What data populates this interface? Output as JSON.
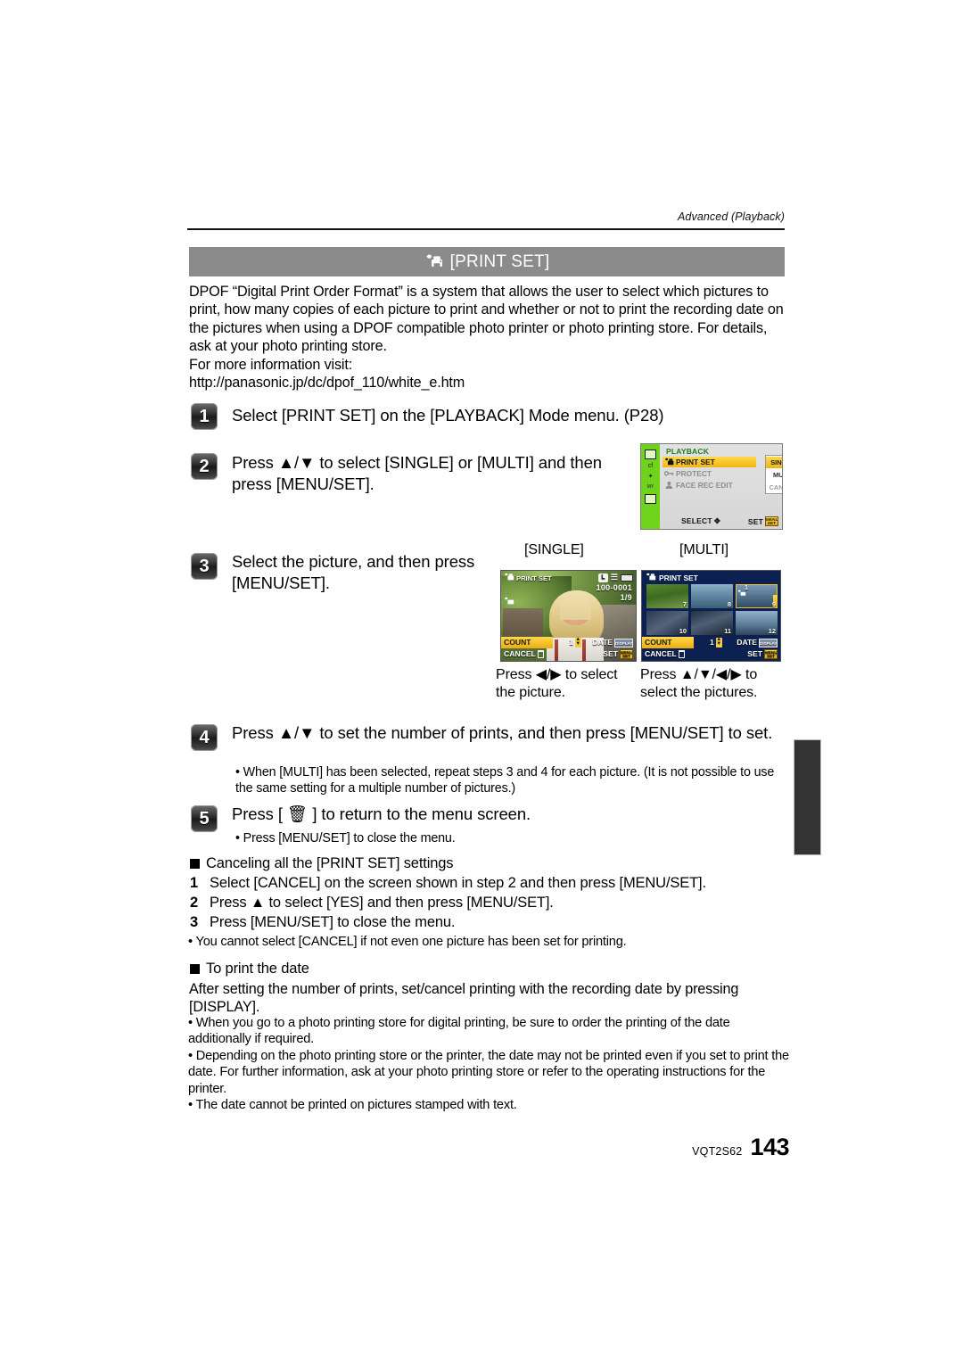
{
  "header": {
    "running_head": "Advanced (Playback)"
  },
  "banner": {
    "icon": "print-set-icon",
    "title": "[PRINT SET]"
  },
  "intro": {
    "paragraph": "DPOF “Digital Print Order Format” is a system that allows the user to select which pictures to print, how many copies of each picture to print and whether or not to print the recording date on the pictures when using a DPOF compatible photo printer or photo printing store. For details, ask at your photo printing store.",
    "more_info_label": "For more information visit:",
    "url": "http://panasonic.jp/dc/dpof_110/white_e.htm"
  },
  "steps": [
    {
      "num": "1",
      "text": "Select [PRINT SET] on the [PLAYBACK] Mode menu. (P28)"
    },
    {
      "num": "2",
      "text": "Press ▲/▼ to select [SINGLE] or [MULTI] and then press [MENU/SET]."
    },
    {
      "num": "3",
      "text": "Select the picture, and then press [MENU/SET]."
    },
    {
      "num": "4",
      "text": "Press ▲/▼ to set the number of prints, and then press [MENU/SET] to set."
    },
    {
      "num": "5",
      "text": "Press [ 🗑 ] to return to the menu screen."
    }
  ],
  "step4_note": "• When [MULTI] has been selected, repeat steps 3 and 4 for each picture. (It is not possible to use the same setting for a multiple number of pictures.)",
  "step5_note": "• Press [MENU/SET] to close the menu.",
  "menu_screen": {
    "title": "PLAYBACK",
    "rows": [
      {
        "label": "PRINT SET",
        "icon": "print-set-icon",
        "selected": true
      },
      {
        "label": "PROTECT",
        "icon": "protect-key-icon",
        "selected": false
      },
      {
        "label": "FACE REC EDIT",
        "icon": "face-rec-icon",
        "selected": false
      }
    ],
    "popup_options": [
      {
        "label": "SINGLE",
        "selected": true
      },
      {
        "label": "MULTI",
        "selected": false
      },
      {
        "label": "CANCEL",
        "selected": false
      }
    ],
    "footer_left": "SELECT",
    "footer_left_icon": "four-way-cursor-icon",
    "footer_right": "SET",
    "footer_right_icon": "menu-set-button-icon",
    "rail_icons": [
      "rec-camera-icon",
      "cf-custom-icon",
      "setup-wrench-icon",
      "my-menu-icon",
      "playback-icon"
    ]
  },
  "captions": {
    "single": "[SINGLE]",
    "multi": "[MULTI]"
  },
  "single_screen": {
    "osd_title": "PRINT SET",
    "osd_title_icon": "print-set-icon",
    "quality_chip": "L",
    "aspect_icon": "aspect-icon",
    "battery_icon": "battery-icon",
    "file_number": "100-0001",
    "picture_index": "1/9",
    "count_label": "COUNT",
    "count_value": "1",
    "stepper_icon": "up-down-stepper-icon",
    "date_label": "DATE",
    "date_chip": "DISPLAY",
    "cancel_label": "CANCEL",
    "cancel_icon": "trash-icon",
    "set_label": "SET",
    "set_icon": "menu-set-button-icon"
  },
  "multi_screen": {
    "osd_title": "PRINT SET",
    "osd_title_icon": "print-set-icon",
    "thumbs": [
      {
        "num": "7",
        "selected": false,
        "print_count": ""
      },
      {
        "num": "8",
        "selected": false,
        "print_count": ""
      },
      {
        "num": "9",
        "selected": true,
        "print_count": "1"
      },
      {
        "num": "10",
        "selected": false,
        "print_count": ""
      },
      {
        "num": "11",
        "selected": false,
        "print_count": ""
      },
      {
        "num": "12",
        "selected": false,
        "print_count": ""
      }
    ],
    "count_label": "COUNT",
    "count_value": "1",
    "date_label": "DATE",
    "date_chip": "DISPLAY",
    "cancel_label": "CANCEL",
    "cancel_icon": "trash-icon",
    "set_label": "SET",
    "set_icon": "menu-set-button-icon"
  },
  "hints": {
    "single": "Press ◀/▶ to select the picture.",
    "multi": "Press ▲/▼/◀/▶ to select the pictures."
  },
  "cancel_section": {
    "heading": "Canceling all the [PRINT SET] settings",
    "items": [
      {
        "n": "1",
        "text": "Select [CANCEL] on the screen shown in step 2 and then press [MENU/SET]."
      },
      {
        "n": "2",
        "text": "Press ▲ to select [YES] and then press [MENU/SET]."
      },
      {
        "n": "3",
        "text": "Press [MENU/SET] to close the menu."
      }
    ],
    "note": "• You cannot select [CANCEL] if not even one picture has been set for printing."
  },
  "date_section": {
    "heading": "To print the date",
    "paragraph": "After setting the number of prints, set/cancel printing with the recording date by pressing [DISPLAY].",
    "notes": [
      "• When you go to a photo printing store for digital printing, be sure to order the printing of the date additionally if required.",
      "• Depending on the photo printing store or the printer, the date may not be printed even if you set to print the date. For further information, ask at your photo printing store or refer to the operating instructions for the printer.",
      "• The date cannot be printed on pictures stamped with text."
    ]
  },
  "footer": {
    "doc_code": "VQT2S62",
    "page_number": "143"
  },
  "colors": {
    "banner_bg": "#8b8b8b",
    "menu_highlight": "#f2b417",
    "menu_rail": "#6fd21b",
    "multi_bg": "#0d2052",
    "edge_tab": "#333333"
  }
}
